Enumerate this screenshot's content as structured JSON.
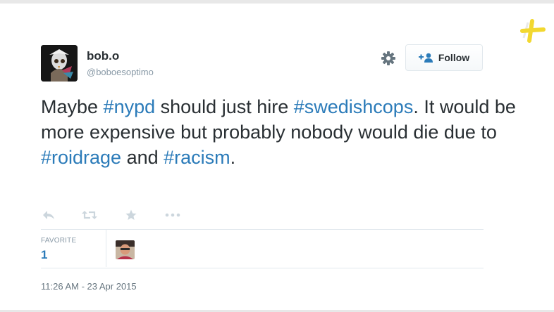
{
  "user": {
    "display_name": "bob.o",
    "screen_name": "@boboesoptimo",
    "avatar_icon": "owl-avatar"
  },
  "follow_button": {
    "label": "Follow",
    "icon": "add-user-icon"
  },
  "settings_icon": "gear-icon",
  "tweet": {
    "segments": [
      {
        "text": "Maybe ",
        "hashtag": false
      },
      {
        "text": "#nypd",
        "hashtag": true
      },
      {
        "text": " should just hire ",
        "hashtag": false
      },
      {
        "text": "#swedishcops",
        "hashtag": true
      },
      {
        "text": ". It would be more expensive but probably nobody would die due to ",
        "hashtag": false
      },
      {
        "text": "#roidrage",
        "hashtag": true
      },
      {
        "text": " and ",
        "hashtag": false
      },
      {
        "text": "#racism",
        "hashtag": true
      },
      {
        "text": ".",
        "hashtag": false
      }
    ]
  },
  "actions": [
    {
      "name": "reply",
      "icon": "reply-icon"
    },
    {
      "name": "retweet",
      "icon": "retweet-icon"
    },
    {
      "name": "favorite",
      "icon": "star-icon"
    },
    {
      "name": "more",
      "icon": "more-icon"
    }
  ],
  "stats": {
    "favorite_label": "FAVORITE",
    "favorite_count": "1"
  },
  "timestamp": "11:26 AM - 23 Apr 2015",
  "colors": {
    "hashtag": "#2b7bb9",
    "text": "#292f33",
    "muted": "#8899a6",
    "brand_plus": "#f2d830"
  }
}
